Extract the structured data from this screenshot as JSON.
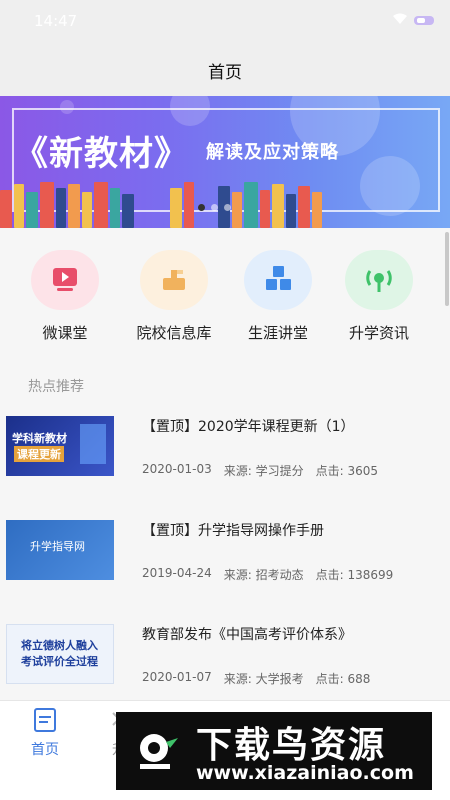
{
  "status_bar": {
    "time": "14:47"
  },
  "header": {
    "title": "首页"
  },
  "banner": {
    "headline": "《新教材》",
    "subtitle": "解读及应对策略"
  },
  "categories": [
    {
      "label": "微课堂",
      "icon": "video-play-icon",
      "bg": "#fde3e8",
      "color": "#e84e6a"
    },
    {
      "label": "院校信息库",
      "icon": "school-icon",
      "bg": "#fdf0de",
      "color": "#f1b25d"
    },
    {
      "label": "生涯讲堂",
      "icon": "cubes-icon",
      "bg": "#e2eefc",
      "color": "#3f8ae8"
    },
    {
      "label": "升学资讯",
      "icon": "broadcast-icon",
      "bg": "#dff5e6",
      "color": "#3fc26a"
    }
  ],
  "section": {
    "title": "热点推荐"
  },
  "news": [
    {
      "title": "【置顶】2020学年课程更新（1）",
      "date": "2020-01-03",
      "source": "来源: 学习提分",
      "clicks": "点击: 3605",
      "thumb": {
        "line1": "学科新教材",
        "line2": "课程更新"
      }
    },
    {
      "title": "【置顶】升学指导网操作手册",
      "date": "2019-04-24",
      "source": "来源: 招考动态",
      "clicks": "点击: 138699",
      "thumb": {
        "line1": "升学指导网"
      }
    },
    {
      "title": "教育部发布《中国高考评价体系》",
      "date": "2020-01-07",
      "source": "来源: 大学报考",
      "clicks": "点击: 688",
      "thumb": {
        "line1": "将立德树人融入",
        "line2": "考试评价全过程"
      }
    }
  ],
  "tabbar": {
    "items": [
      {
        "label": "首页",
        "icon": "home-doc-icon",
        "active": true
      },
      {
        "label": "升",
        "icon": "tab2-icon",
        "active": false
      }
    ]
  },
  "watermark": {
    "brand": "下载鸟资源",
    "url": "www.xiazainiao.com"
  },
  "colors": {
    "accent": "#3f79dd",
    "banner_start": "#8b58e6",
    "banner_end": "#78a8f5"
  }
}
